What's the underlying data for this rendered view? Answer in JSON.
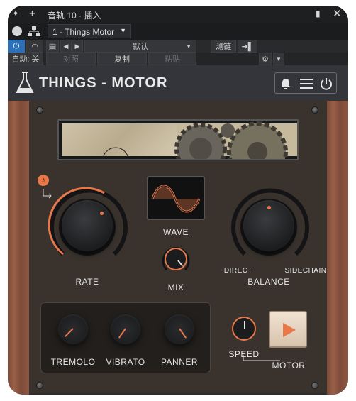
{
  "titlebar": {
    "title": "音轨 10 · 插入"
  },
  "track": {
    "preset_name": "1 - Things Motor"
  },
  "preset_bar": {
    "preset": "默认",
    "sidechain": "测链"
  },
  "edit_bar": {
    "auto": "自动: 关",
    "compare": "对照",
    "copy": "复制",
    "paste": "粘贴"
  },
  "plugin": {
    "name": "THINGS - MOTOR"
  },
  "controls": {
    "wave_label": "WAVE",
    "rate_label": "RATE",
    "mix_label": "MIX",
    "balance_label": "BALANCE",
    "direct_label": "DIRECT",
    "sidechain_label": "SIDECHAIN",
    "tremolo_label": "TREMOLO",
    "vibrato_label": "VIBRATO",
    "panner_label": "PANNER",
    "speed_label": "SPEED",
    "motor_label": "MOTOR"
  },
  "colors": {
    "accent": "#e8774a",
    "panel": "#3a332d",
    "wood": "#8d5742"
  }
}
